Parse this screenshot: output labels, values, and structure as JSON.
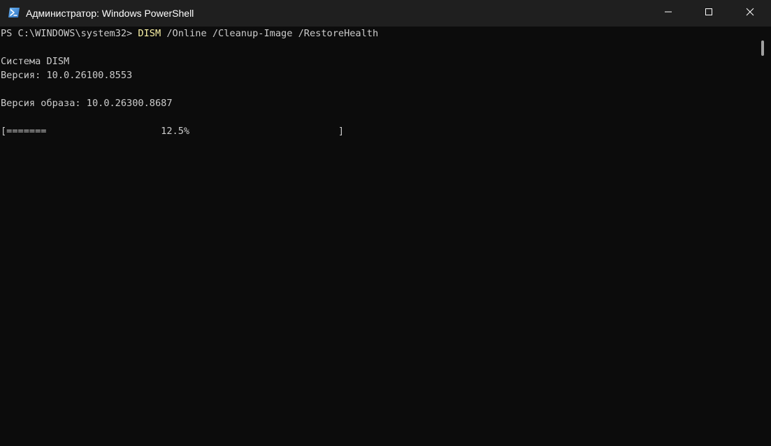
{
  "window": {
    "title": "Администратор: Windows PowerShell",
    "icon": "powershell-icon"
  },
  "controls": {
    "minimize_icon": "minimize-icon",
    "maximize_icon": "maximize-icon",
    "close_icon": "close-icon"
  },
  "terminal": {
    "prompt": "PS C:\\WINDOWS\\system32> ",
    "command": "DISM",
    "command_args": " /Online /Cleanup-Image /RestoreHealth",
    "tool_name": "Система DISM",
    "tool_version": "Версия: 10.0.26100.8553",
    "image_version": "Версия образа: 10.0.26300.8687",
    "progress_line": "[=======                    12.5%                          ]",
    "progress_percent": 12.5
  },
  "colors": {
    "background": "#0c0c0c",
    "titlebar": "#1f1f1f",
    "text": "#cccccc",
    "command": "#f9f1a5",
    "close_hover": "#c42b1c"
  }
}
